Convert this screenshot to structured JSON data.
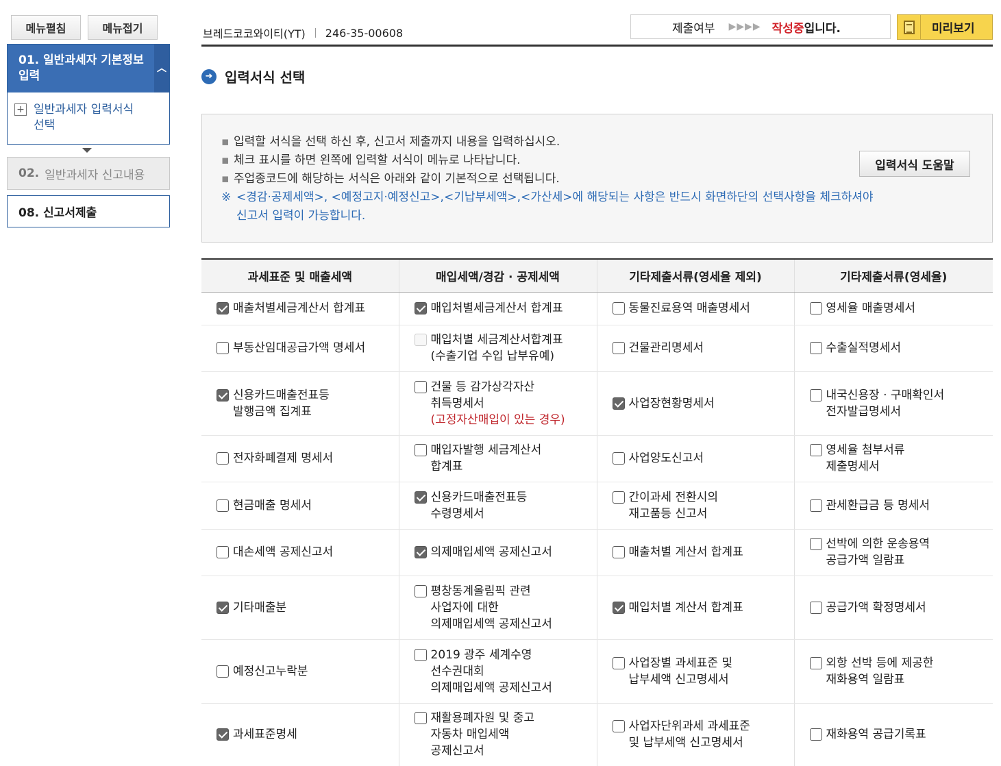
{
  "sidebar": {
    "expand_label": "메뉴펼침",
    "collapse_label": "메뉴접기",
    "step1": {
      "title": "01. 일반과세자 기본정보\n입력",
      "sub_item": "일반과세자 입력서식\n선택"
    },
    "step2": {
      "num": "02.",
      "title": "일반과세자 신고내용"
    },
    "step3": {
      "title": "08. 신고서제출"
    }
  },
  "header": {
    "company": "브레드코코와이티(YT)",
    "biz_no": "246-35-00608",
    "status_label": "제출여부",
    "status_arrows": "▶▶▶▶",
    "status_value_red": "작성중",
    "status_value_rest": "입니다.",
    "preview_label": "미리보기"
  },
  "section": {
    "title": "입력서식 선택"
  },
  "info": {
    "lines": [
      "입력할 서식을 선택 하신 후, 신고서 제출까지 내용을 입력하십시오.",
      "체크 표시를 하면 왼쪽에 입력할 서식이 메뉴로 나타납니다.",
      "주업종코드에 해당하는 서식은 아래와 같이 기본적으로 선택됩니다."
    ],
    "note_mark": "※",
    "note1": "<경감·공제세액>, <예정고지·예정신고>,<기납부세액>,<가산세>에 해당되는 사항은 반드시  화면하단의 선택사항을 체크하셔야",
    "note2": "신고서 입력이 가능합니다.",
    "help_button": "입력서식 도움말"
  },
  "table": {
    "headers": [
      "과세표준 및 매출세액",
      "매입세액/경감 · 공제세액",
      "기타제출서류(영세율 제외)",
      "기타제출서류(영세율)"
    ],
    "rows": [
      [
        {
          "label": "매출처별세금계산서 합계표",
          "checked": true
        },
        {
          "label": "매입처별세금계산서 합계표",
          "checked": true
        },
        {
          "label": "동물진료용역 매출명세서",
          "checked": false
        },
        {
          "label": "영세율 매출명세서",
          "checked": false
        }
      ],
      [
        {
          "label": "부동산임대공급가액 명세서",
          "checked": false
        },
        {
          "label": "매입처별 세금계산서합계표\n(수출기업 수입 납부유예)",
          "checked": false,
          "disabled": true
        },
        {
          "label": "건물관리명세서",
          "checked": false
        },
        {
          "label": "수출실적명세서",
          "checked": false
        }
      ],
      [
        {
          "label": "신용카드매출전표등\n발행금액 집계표",
          "checked": true
        },
        {
          "label": "건물 등 감가상각자산\n취득명세서",
          "sub": "(고정자산매입이 있는 경우)",
          "checked": false
        },
        {
          "label": "사업장현황명세서",
          "checked": true
        },
        {
          "label": "내국신용장 · 구매확인서\n전자발급명세서",
          "checked": false
        }
      ],
      [
        {
          "label": "전자화폐결제 명세서",
          "checked": false
        },
        {
          "label": "매입자발행 세금계산서\n합계표",
          "checked": false
        },
        {
          "label": "사업양도신고서",
          "checked": false
        },
        {
          "label": "영세율 첨부서류\n제출명세서",
          "checked": false
        }
      ],
      [
        {
          "label": "현금매출 명세서",
          "checked": false
        },
        {
          "label": "신용카드매출전표등\n수령명세서",
          "checked": true
        },
        {
          "label": "간이과세 전환시의\n재고품등 신고서",
          "checked": false
        },
        {
          "label": "관세환급금 등 명세서",
          "checked": false
        }
      ],
      [
        {
          "label": "대손세액 공제신고서",
          "checked": false
        },
        {
          "label": "의제매입세액 공제신고서",
          "checked": true
        },
        {
          "label": "매출처별 계산서 합계표",
          "checked": false
        },
        {
          "label": "선박에 의한 운송용역\n공급가액 일람표",
          "checked": false
        }
      ],
      [
        {
          "label": "기타매출분",
          "checked": true
        },
        {
          "label": "평창동계올림픽 관련\n사업자에 대한\n의제매입세액 공제신고서",
          "checked": false
        },
        {
          "label": "매입처별 계산서 합계표",
          "checked": true
        },
        {
          "label": "공급가액 확정명세서",
          "checked": false
        }
      ],
      [
        {
          "label": "예정신고누락분",
          "checked": false
        },
        {
          "label": "2019 광주 세계수영\n선수권대회\n의제매입세액 공제신고서",
          "checked": false
        },
        {
          "label": "사업장별 과세표준 및\n납부세액 신고명세서",
          "checked": false
        },
        {
          "label": "외항 선박 등에 제공한\n재화용역 일람표",
          "checked": false
        }
      ],
      [
        {
          "label": "과세표준명세",
          "checked": true
        },
        {
          "label": "재활용폐자원 및 중고\n자동차 매입세액\n공제신고서",
          "checked": false
        },
        {
          "label": "사업자단위과세 과세표준\n및 납부세액 신고명세서",
          "checked": false
        },
        {
          "label": "재화용역 공급기록표",
          "checked": false
        }
      ]
    ]
  }
}
